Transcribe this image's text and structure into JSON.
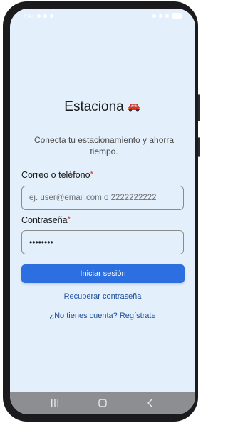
{
  "status_bar": {
    "time": "7:47"
  },
  "app": {
    "title": "Estaciona",
    "title_icon": "car-icon",
    "tagline": "Conecta tu estacionamiento y ahorra tiempo."
  },
  "login_form": {
    "email_label": "Correo o teléfono",
    "email_required_mark": "*",
    "email_placeholder": "ej. user@email.com o 2222222222",
    "password_label": "Contraseña",
    "password_required_mark": "*",
    "password_value_masked": "••••••••",
    "submit_label": "Iniciar sesión"
  },
  "links": {
    "recover_password": "Recuperar contraseña",
    "register": "¿No tienes cuenta? Regístrate"
  },
  "navigation_bar": {
    "icons": [
      "recent-apps-icon",
      "home-icon",
      "back-icon"
    ]
  },
  "colors": {
    "screen_background": "#e3effb",
    "primary_button": "#2c6fe0",
    "link": "#1f4f9a",
    "required": "#d32f2f"
  }
}
